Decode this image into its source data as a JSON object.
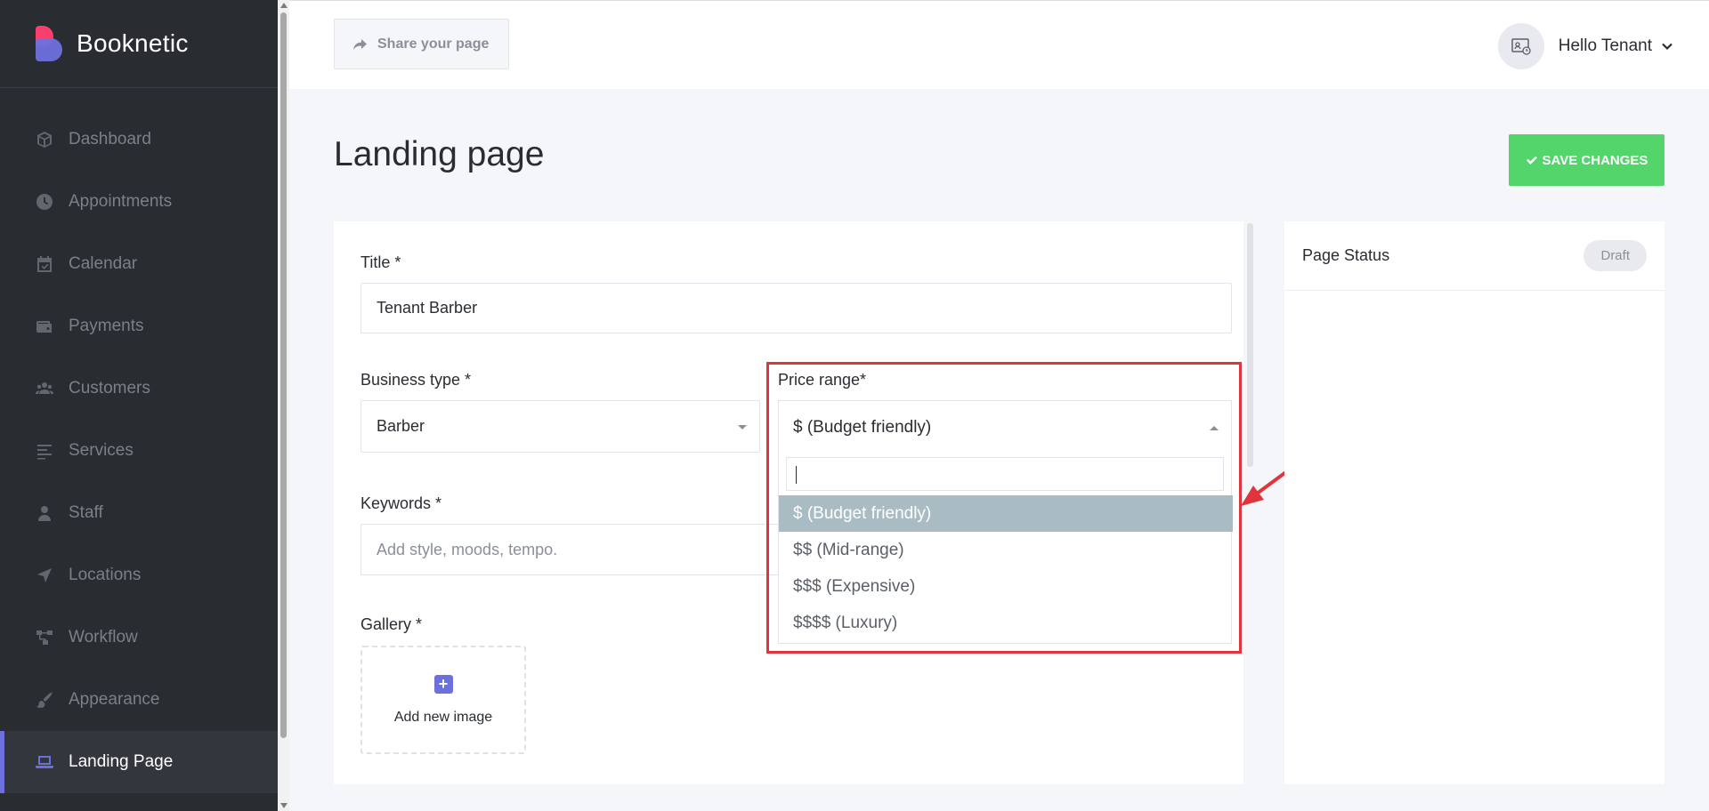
{
  "brand": {
    "name": "Booknetic"
  },
  "sidebar": {
    "items": [
      {
        "label": "Dashboard",
        "icon": "cube-icon"
      },
      {
        "label": "Appointments",
        "icon": "clock-icon"
      },
      {
        "label": "Calendar",
        "icon": "calendar-icon"
      },
      {
        "label": "Payments",
        "icon": "wallet-icon"
      },
      {
        "label": "Customers",
        "icon": "users-icon"
      },
      {
        "label": "Services",
        "icon": "list-icon"
      },
      {
        "label": "Staff",
        "icon": "user-icon"
      },
      {
        "label": "Locations",
        "icon": "location-arrow-icon"
      },
      {
        "label": "Workflow",
        "icon": "workflow-icon"
      },
      {
        "label": "Appearance",
        "icon": "brush-icon"
      },
      {
        "label": "Landing Page",
        "icon": "laptop-icon",
        "active": true
      }
    ]
  },
  "header": {
    "share_label": "Share your page",
    "user_greeting": "Hello Tenant"
  },
  "main": {
    "page_title": "Landing page",
    "save_label": "SAVE CHANGES"
  },
  "form": {
    "title_label": "Title *",
    "title_value": "Tenant Barber",
    "business_type_label": "Business type *",
    "business_type_value": "Barber",
    "price_range_label": "Price range*",
    "price_range_value": "$ (Budget friendly)",
    "price_range_options": [
      "$ (Budget friendly)",
      "$$ (Mid-range)",
      "$$$ (Expensive)",
      "$$$$ (Luxury)"
    ],
    "keywords_label": "Keywords *",
    "keywords_placeholder": "Add style, moods, tempo.",
    "gallery_label": "Gallery *",
    "add_image_label": "Add new image"
  },
  "status": {
    "title": "Page Status",
    "badge": "Draft"
  },
  "colors": {
    "sidebar_bg": "#292d32",
    "accent": "#6c70dc",
    "save_green": "#53d56c",
    "selected_option": "#a9bcc4",
    "annotation_red": "#e0353d"
  }
}
